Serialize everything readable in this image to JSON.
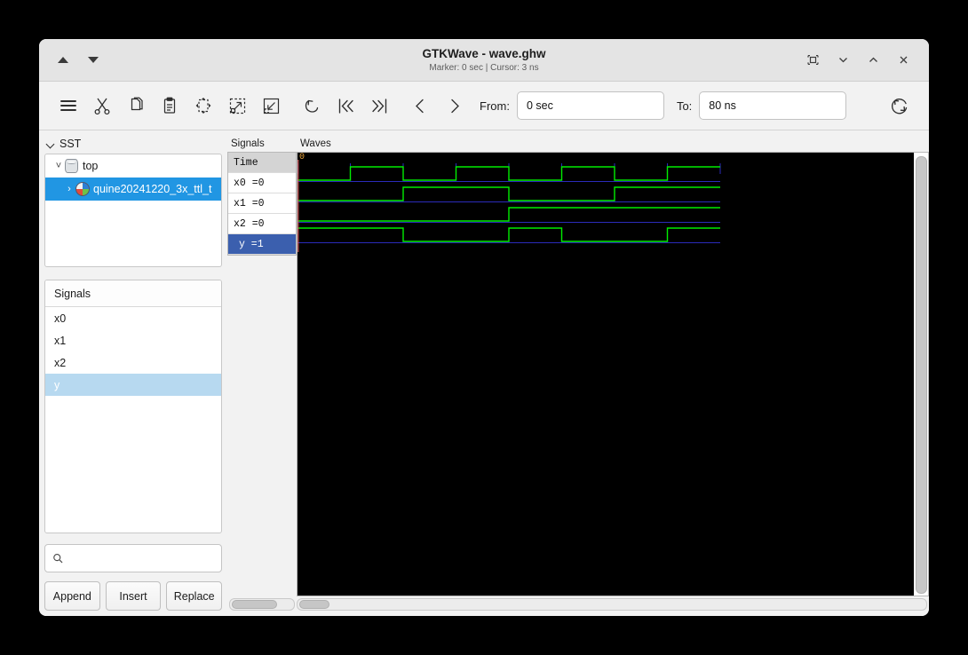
{
  "window": {
    "title": "GTKWave - wave.ghw",
    "subtitle": "Marker: 0 sec  |  Cursor: 3 ns",
    "nav_up_icon": "triangle-up-icon",
    "nav_down_icon": "triangle-down-icon",
    "controls": [
      {
        "name": "restore-window-button",
        "icon": "restore-box-icon"
      },
      {
        "name": "minimize-window-button",
        "icon": "chevron-down-icon"
      },
      {
        "name": "maximize-window-button",
        "icon": "chevron-up-icon"
      },
      {
        "name": "close-window-button",
        "icon": "close-x-icon"
      }
    ]
  },
  "toolbar": {
    "icons": [
      {
        "name": "menu-button",
        "icon": "hamburger-icon"
      },
      {
        "name": "cut-button",
        "icon": "scissors-icon"
      },
      {
        "name": "copy-button",
        "icon": "copy-pages-icon"
      },
      {
        "name": "paste-button",
        "icon": "clipboard-icon"
      },
      {
        "name": "zoom-fit-button",
        "icon": "zoom-fit-icon"
      },
      {
        "name": "zoom-in-button",
        "icon": "zoom-in-arrow-icon"
      },
      {
        "name": "zoom-out-button",
        "icon": "zoom-out-arrow-icon"
      },
      {
        "name": "undo-button",
        "icon": "undo-arrow-icon"
      },
      {
        "name": "go-to-start-button",
        "icon": "skip-start-icon"
      },
      {
        "name": "go-to-end-button",
        "icon": "skip-end-icon"
      },
      {
        "name": "previous-edge-button",
        "icon": "chevron-left-icon"
      },
      {
        "name": "next-edge-button",
        "icon": "chevron-right-icon"
      }
    ],
    "from_label": "From:",
    "from_value": "0 sec",
    "to_label": "To:",
    "to_value": "80 ns",
    "reload_icon": "reload-circle-icon"
  },
  "sidebar": {
    "sst_label": "SST",
    "tree": [
      {
        "label": "top",
        "icon": "cylinder-icon",
        "selected": false,
        "expander": "chevron-down-icon"
      },
      {
        "label": "quine20241220_3x_ttl_t",
        "icon": "sphere-icon",
        "selected": true,
        "expander": "chevron-right-icon"
      }
    ],
    "signals_title": "Signals",
    "signals": [
      {
        "label": "x0",
        "selected": false
      },
      {
        "label": "x1",
        "selected": false
      },
      {
        "label": "x2",
        "selected": false
      },
      {
        "label": "y",
        "selected": true
      }
    ],
    "search_placeholder": "",
    "search_value": "",
    "search_icon": "search-icon",
    "buttons": [
      {
        "label": "Append",
        "name": "append-button"
      },
      {
        "label": "Insert",
        "name": "insert-button"
      },
      {
        "label": "Replace",
        "name": "replace-button"
      }
    ]
  },
  "wave_names_panel": {
    "header": "Signals",
    "rows": [
      {
        "label": "Time",
        "kind": "time",
        "selected": false
      },
      {
        "label": "x0 =0",
        "kind": "signal",
        "selected": false
      },
      {
        "label": "x1 =0",
        "kind": "signal",
        "selected": false
      },
      {
        "label": "x2 =0",
        "kind": "signal",
        "selected": false
      },
      {
        "label": "y =1",
        "kind": "signal",
        "selected": true
      }
    ]
  },
  "waves_panel": {
    "header": "Waves",
    "zero_marker_label": "0"
  },
  "chart_data": {
    "type": "line",
    "title": "GTKWave digital waveform viewer",
    "xlabel": "Time",
    "time_range_ns": [
      0,
      80
    ],
    "pixels_per_ns": 5.95,
    "colors": {
      "background": "#000000",
      "trace_high": "#00ee00",
      "baseline": "#2b2bbb",
      "grid": "#2b2bbb",
      "marker": "#e06060",
      "cursor": "#e8a33d"
    },
    "grid_interval_ns": 10,
    "marker_time_ns": 0,
    "cursor_time_ns": 3,
    "series": [
      {
        "name": "x0",
        "value_at_cursor": 0,
        "period_ns": 20,
        "transitions_ns": [
          0,
          10,
          20,
          30,
          40,
          50,
          60,
          70
        ],
        "levels": [
          0,
          1,
          0,
          1,
          0,
          1,
          0,
          1
        ]
      },
      {
        "name": "x1",
        "value_at_cursor": 0,
        "period_ns": 40,
        "transitions_ns": [
          0,
          20,
          40,
          60
        ],
        "levels": [
          0,
          1,
          0,
          1
        ]
      },
      {
        "name": "x2",
        "value_at_cursor": 0,
        "period_ns": 80,
        "transitions_ns": [
          0,
          40
        ],
        "levels": [
          0,
          1
        ]
      },
      {
        "name": "y",
        "value_at_cursor": 1,
        "period_ns": 0,
        "transitions_ns": [
          0,
          20,
          40,
          50,
          70
        ],
        "levels": [
          1,
          0,
          1,
          0,
          1
        ]
      }
    ]
  }
}
